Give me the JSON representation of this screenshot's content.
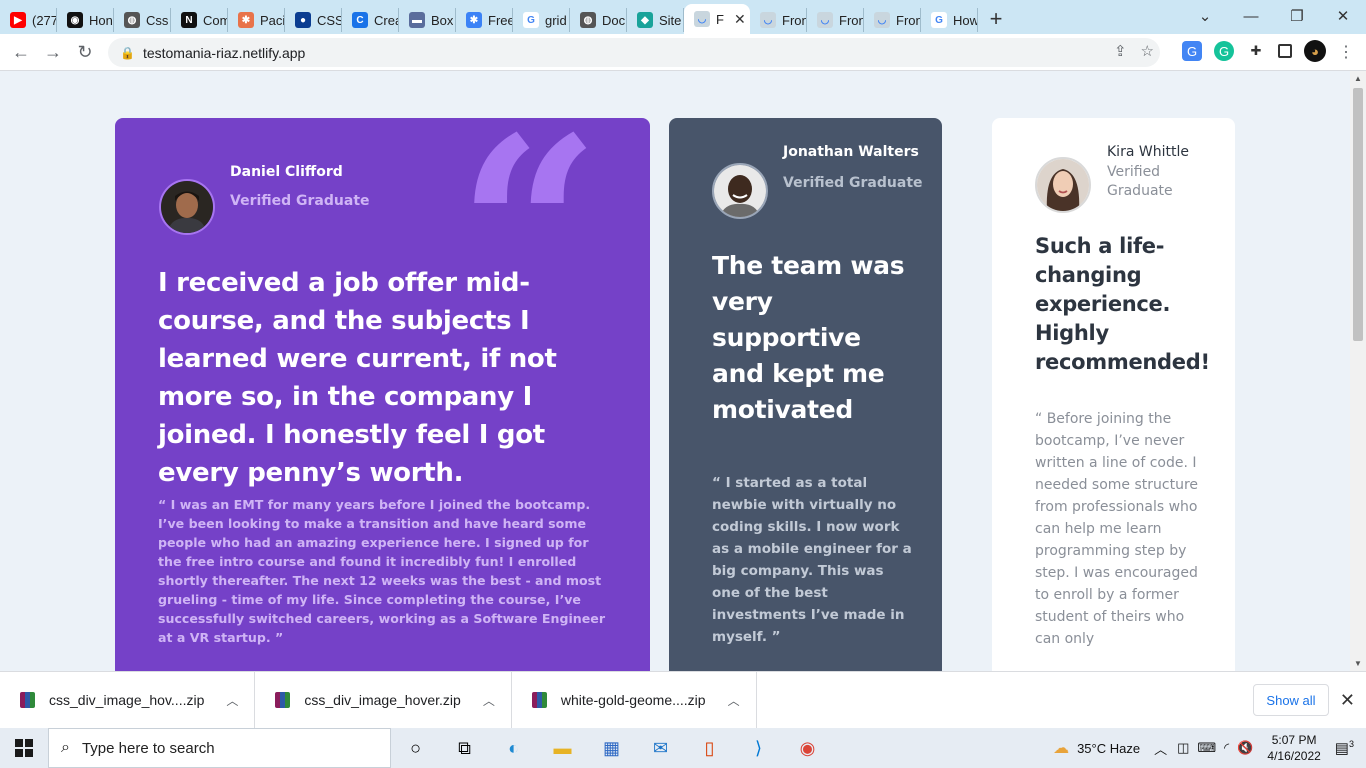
{
  "browser": {
    "tabs": [
      {
        "label": "(277",
        "fav_color": "#ff0000",
        "fav": "▶"
      },
      {
        "label": "Hon",
        "fav_color": "#111111",
        "fav": "◉"
      },
      {
        "label": "Css",
        "fav_color": "#555555",
        "fav": "◍"
      },
      {
        "label": "Com",
        "fav_color": "#111111",
        "fav": "N"
      },
      {
        "label": "Pacif",
        "fav_color": "#e8734a",
        "fav": "✱"
      },
      {
        "label": "CSS",
        "fav_color": "#0b3d91",
        "fav": "●"
      },
      {
        "label": "Crea",
        "fav_color": "#1a73e8",
        "fav": "C"
      },
      {
        "label": "Box",
        "fav_color": "#5a6d9c",
        "fav": "▬"
      },
      {
        "label": "Free",
        "fav_color": "#3b82f6",
        "fav": "✱"
      },
      {
        "label": "grid",
        "fav_color": "#ffffff",
        "fav": "G"
      },
      {
        "label": "Doc",
        "fav_color": "#555555",
        "fav": "◍"
      },
      {
        "label": "Site",
        "fav_color": "#1aa39a",
        "fav": "◆"
      },
      {
        "label": "F",
        "fav_color": "#c9d6de",
        "fav": "◡",
        "active": true
      },
      {
        "label": "Fron",
        "fav_color": "#c9d6de",
        "fav": "◡"
      },
      {
        "label": "Fron",
        "fav_color": "#c9d6de",
        "fav": "◡"
      },
      {
        "label": "Fron",
        "fav_color": "#c9d6de",
        "fav": "◡"
      },
      {
        "label": "How",
        "fav_color": "#ffffff",
        "fav": "G"
      }
    ],
    "new_tab": "+",
    "url": "testomania-riaz.netlify.app"
  },
  "page": {
    "colors": {
      "bg": "#ecf2f8",
      "daniel_card": "#7541c8",
      "jonathan_card": "#48556a",
      "kira_card": "#ffffff",
      "quote_mark": "#a775f1"
    },
    "daniel": {
      "name": "Daniel Clifford",
      "role": "Verified Graduate",
      "headline": "I received a job offer mid-course, and the subjects I learned were current, if not more so, in the company I joined. I honestly feel I got every penny’s worth.",
      "body": "“ I was an EMT for many years before I joined the bootcamp. I’ve been looking to make a transition and have heard some people who had an amazing experience here. I signed up for the free intro course and found it incredibly fun! I enrolled shortly thereafter. The next 12 weeks was the best - and most grueling - time of my life. Since completing the course, I’ve successfully switched careers, working as a Software Engineer at a VR startup. ”"
    },
    "jonathan": {
      "name": "Jonathan Walters",
      "role": "Verified Graduate",
      "headline": "The team was very supportive and kept me motivated",
      "body": "“ I started as a total newbie with virtually no coding skills. I now work as a mobile engineer for a big company. This was one of the best investments I’ve made in myself. ”"
    },
    "kira": {
      "name": "Kira Whittle",
      "role": "Verified Graduate",
      "headline": "Such a life-changing experience. Highly recommended!",
      "body": "“ Before joining the bootcamp, I’ve never written a line of code. I needed some structure from professionals who can help me learn programming step by step. I was encouraged to enroll by a former student of theirs who can only"
    }
  },
  "downloads": {
    "items": [
      {
        "name": "css_div_image_hov....zip"
      },
      {
        "name": "css_div_image_hover.zip"
      },
      {
        "name": "white-gold-geome....zip"
      }
    ],
    "show_all": "Show all"
  },
  "taskbar": {
    "search_placeholder": "Type here to search",
    "weather": "35°C  Haze",
    "time": "5:07 PM",
    "date": "4/16/2022",
    "notifications": "3"
  }
}
